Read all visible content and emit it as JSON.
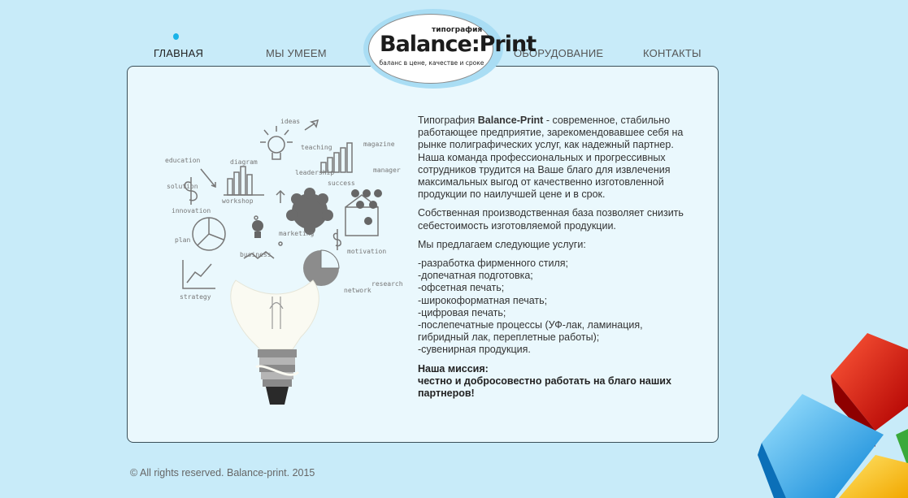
{
  "nav": {
    "items": [
      {
        "label": "ГЛАВНАЯ",
        "active": true
      },
      {
        "label": "МЫ УМЕЕМ",
        "active": false
      },
      {
        "label": "ОБОРУДОВАНИЕ",
        "active": false
      },
      {
        "label": "КОНТАКТЫ",
        "active": false
      }
    ]
  },
  "logo": {
    "small": "типография",
    "main": "Balance:Print",
    "tagline": "баланс в цене, качестве и сроке"
  },
  "illustration": {
    "words": [
      "education",
      "solution",
      "innovation",
      "plan",
      "strategy",
      "diagram",
      "workshop",
      "business",
      "marketing",
      "leadership",
      "teaching",
      "ideas",
      "success",
      "motivation",
      "research",
      "network",
      "manager",
      "magazine"
    ]
  },
  "content": {
    "intro_prefix": "Типография ",
    "intro_brand": "Balance-Print",
    "intro_rest": " - современное, стабильно работающее предприятие, зарекомендовавшее себя на рынке полиграфических услуг, как надежный партнер. Наша команда профессиональных и прогрессивных сотрудников трудится на Ваше благо для извлечения максимальных выгод от качественно изготовленной продукции по наилучшей цене и в срок.",
    "paragraph2": "Собственная производственная база позволяет снизить себестоимость изготовляемой продукции.",
    "services_intro": "Мы предлагаем следующие услуги:",
    "services": [
      "-разработка фирменного стиля;",
      "-допечатная подготовка;",
      "-офсетная печать;",
      "-широкоформатная печать;",
      "-цифровая печать;",
      "-послепечатные процессы (УФ-лак, ламинация, гибридный лак, переплетные работы);",
      "-сувенирная продукция."
    ],
    "mission_title": "Наша миссия:",
    "mission_text": "честно и добросовестно работать на благо наших партнеров!"
  },
  "footer": {
    "text": "© All rights reserved. Balance-print. 2015"
  },
  "colors": {
    "background": "#c8ebf9",
    "panel": "#eaf8fd",
    "accent": "#1ab3e8"
  }
}
